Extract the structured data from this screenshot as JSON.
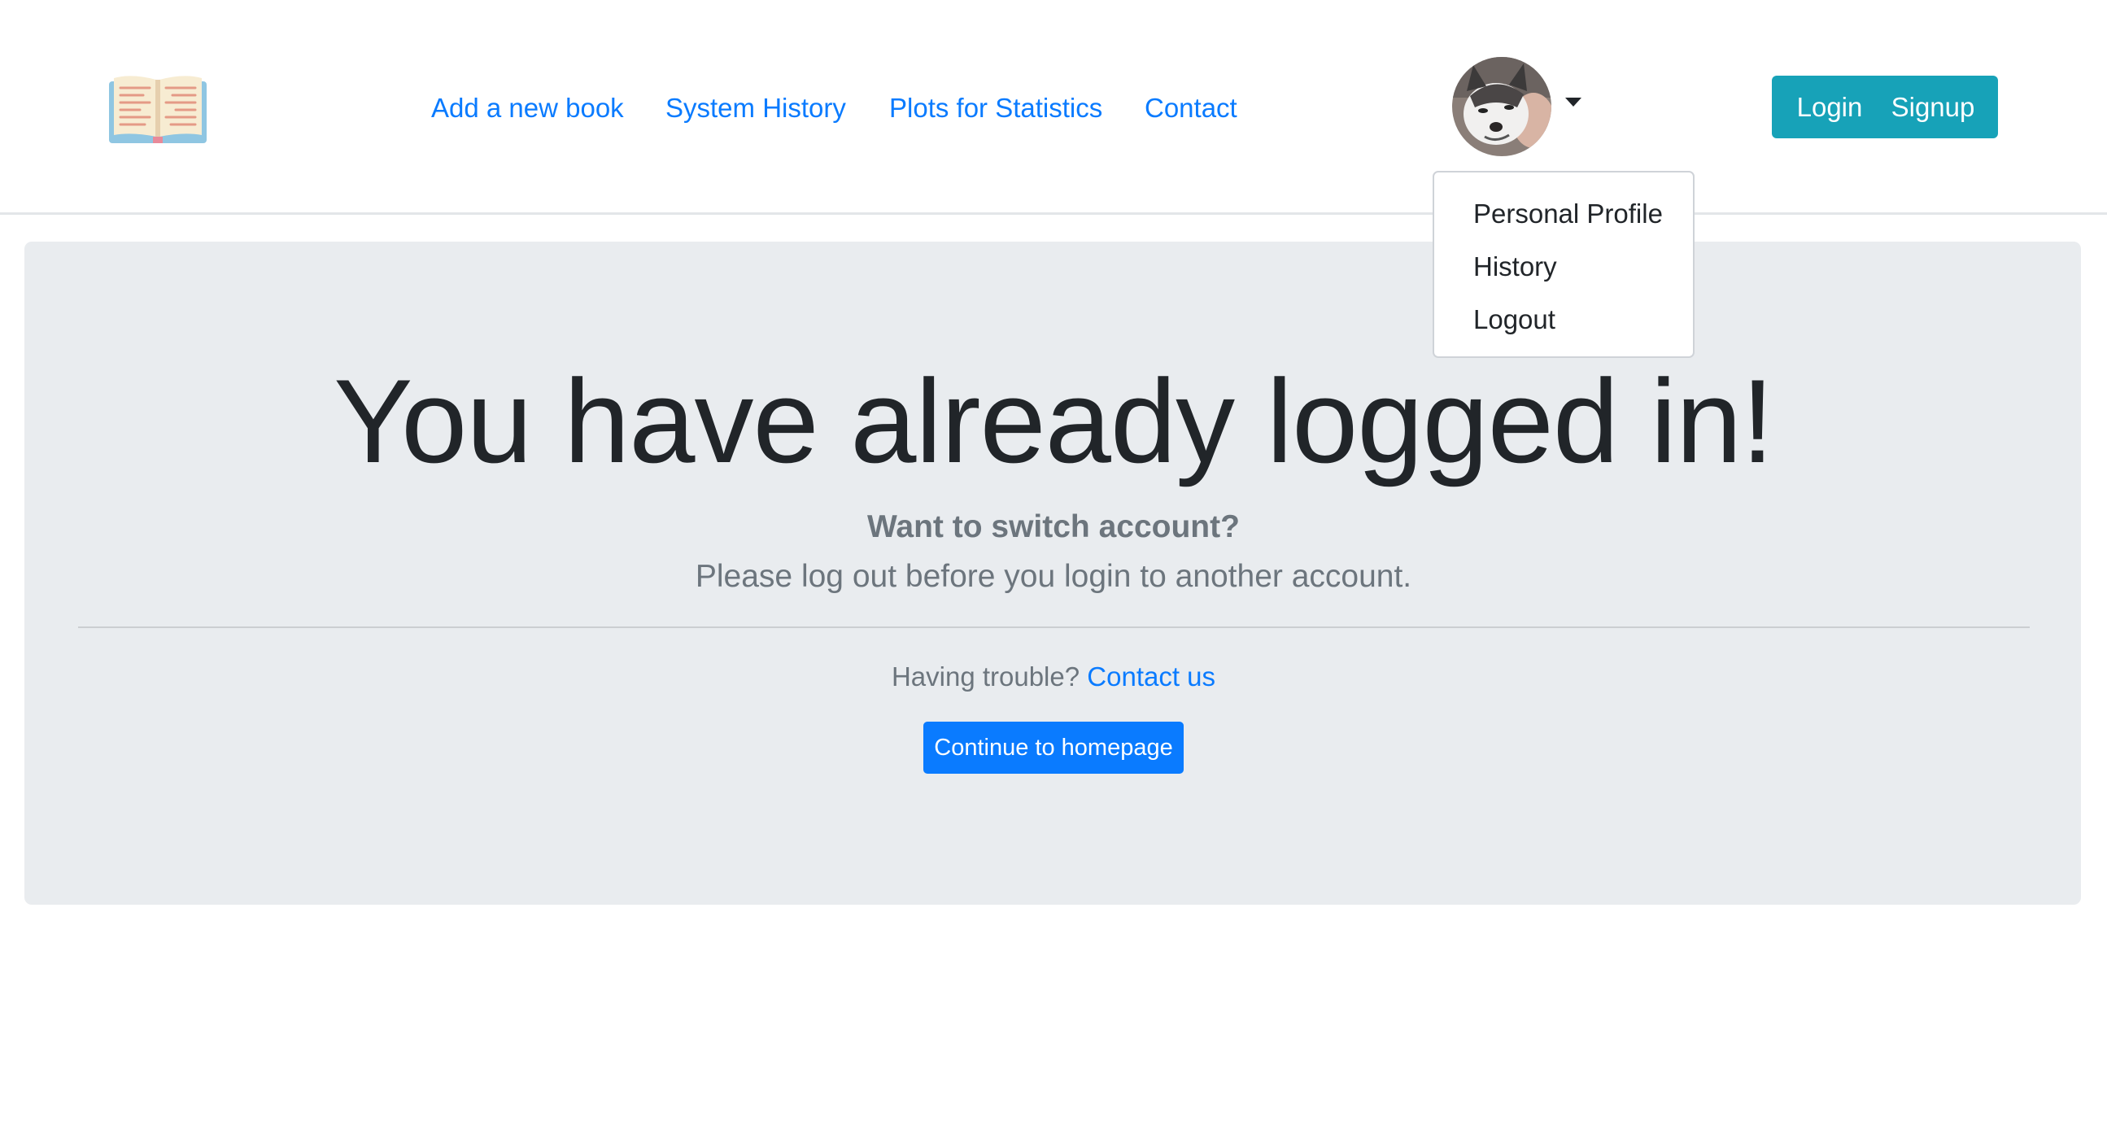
{
  "header": {
    "logo_icon": "open-book-icon",
    "nav": [
      {
        "label": "Add a new book"
      },
      {
        "label": "System History"
      },
      {
        "label": "Plots for Statistics"
      },
      {
        "label": "Contact"
      }
    ],
    "avatar_icon": "user-avatar-husky",
    "auth": {
      "login_label": "Login",
      "signup_label": "Signup"
    }
  },
  "dropdown": {
    "items": [
      {
        "label": "Personal Profile"
      },
      {
        "label": "History"
      },
      {
        "label": "Logout"
      }
    ]
  },
  "jumbotron": {
    "title": "You have already logged in!",
    "subtitle": "Want to switch account?",
    "text": "Please log out before you login to another account.",
    "trouble_text": "Having trouble?",
    "contact_link": "Contact us",
    "continue_button": "Continue to homepage"
  },
  "colors": {
    "link": "#0a7bff",
    "auth_button": "#17a2b8",
    "primary_button": "#0a7bff",
    "jumbotron_bg": "#e9ecef",
    "muted_text": "#6c757d"
  }
}
